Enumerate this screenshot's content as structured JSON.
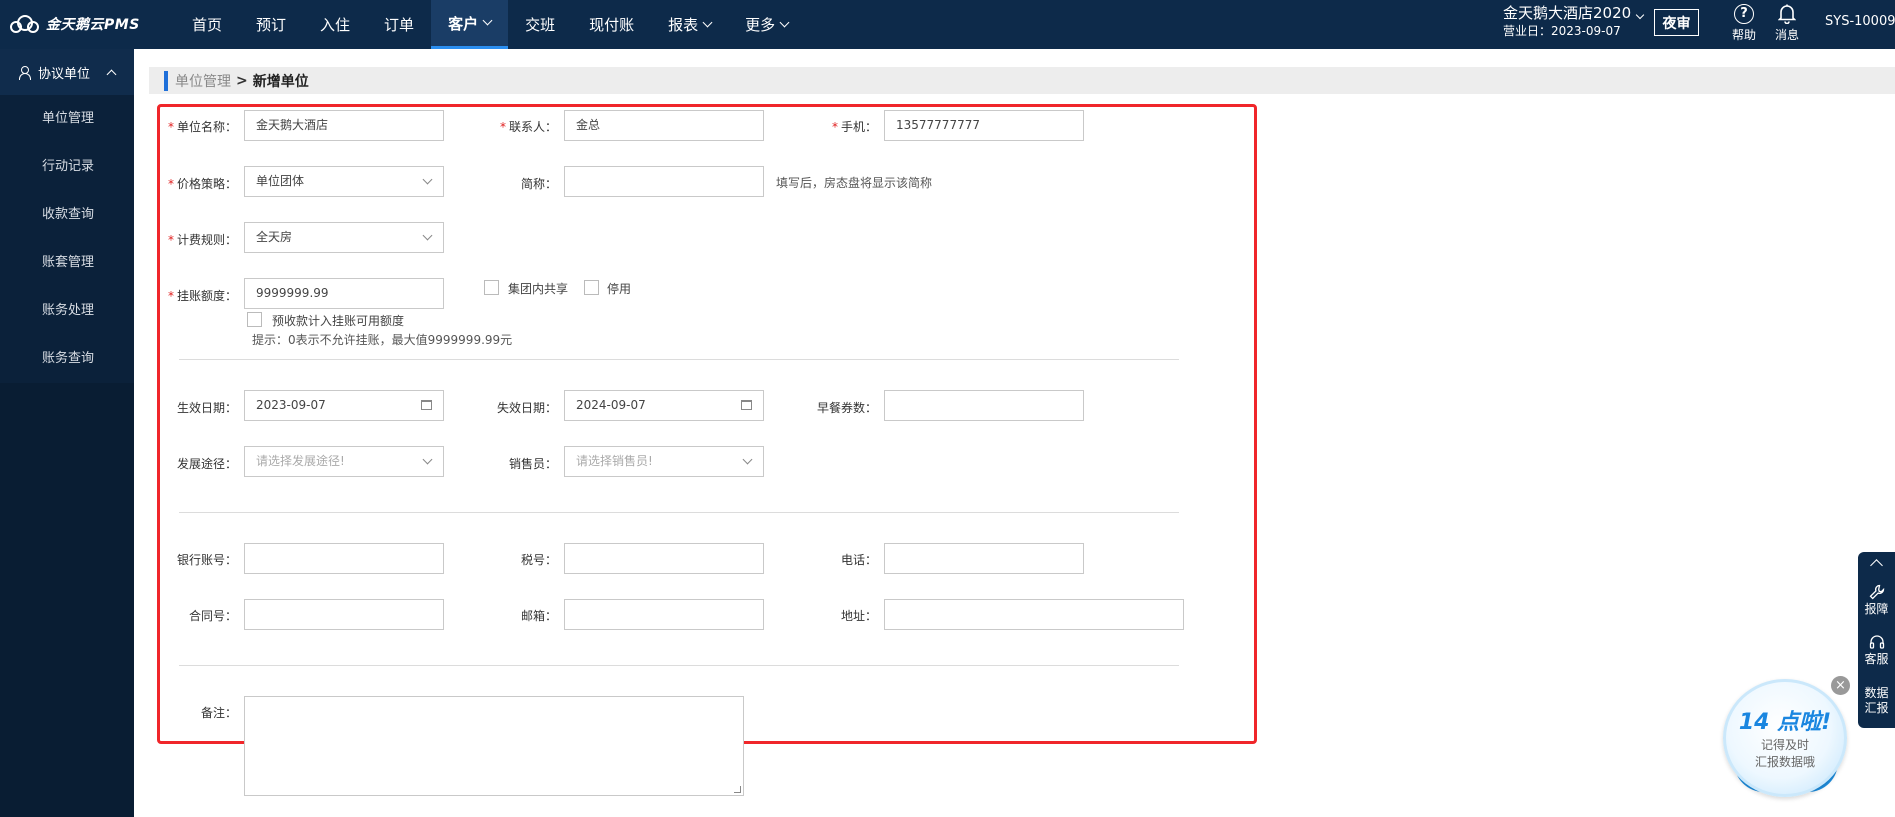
{
  "app": {
    "logo_text": "金天鹅云PMS"
  },
  "nav": {
    "items": [
      {
        "label": "首页"
      },
      {
        "label": "预订"
      },
      {
        "label": "入住"
      },
      {
        "label": "订单"
      },
      {
        "label": "客户"
      },
      {
        "label": "交班"
      },
      {
        "label": "现付账"
      },
      {
        "label": "报表"
      },
      {
        "label": "更多"
      }
    ]
  },
  "header": {
    "hotel_name": "金天鹅大酒店2020",
    "business_date": "营业日：2023-09-07",
    "night_audit": "夜审",
    "help": "帮助",
    "messages": "消息",
    "user": "SYS-10009"
  },
  "sidebar": {
    "group": "协议单位",
    "items": [
      {
        "label": "单位管理"
      },
      {
        "label": "行动记录"
      },
      {
        "label": "收款查询"
      },
      {
        "label": "账套管理"
      },
      {
        "label": "账务处理"
      },
      {
        "label": "账务查询"
      }
    ]
  },
  "breadcrumb": {
    "parent": "单位管理",
    "sep": ">",
    "current": "新增单位"
  },
  "form": {
    "unit_name": {
      "label": "单位名称：",
      "value": "金天鹅大酒店"
    },
    "contact": {
      "label": "联系人：",
      "value": "金总"
    },
    "mobile": {
      "label": "手机：",
      "value": "13577777777"
    },
    "price_policy": {
      "label": "价格策略：",
      "value": "单位团体"
    },
    "short_name": {
      "label": "简称：",
      "value": "",
      "hint": "填写后，房态盘将显示该简称"
    },
    "billing_rule": {
      "label": "计费规则：",
      "value": "全天房"
    },
    "credit_limit": {
      "label": "挂账额度：",
      "value": "9999999.99"
    },
    "group_share": {
      "label": "集团内共享",
      "checked": false
    },
    "disabled": {
      "label": "停用",
      "checked": false
    },
    "prepay_in_limit": {
      "label": "预收款计入挂账可用额度",
      "checked": false
    },
    "credit_hint": "提示：0表示不允许挂账，最大值9999999.99元",
    "effective_date": {
      "label": "生效日期：",
      "value": "2023-09-07"
    },
    "expiry_date": {
      "label": "失效日期：",
      "value": "2024-09-07"
    },
    "breakfast_coupons": {
      "label": "早餐券数：",
      "value": ""
    },
    "dev_channel": {
      "label": "发展途径：",
      "placeholder": "请选择发展途径!"
    },
    "salesperson": {
      "label": "销售员：",
      "placeholder": "请选择销售员!"
    },
    "bank_account": {
      "label": "银行账号：",
      "value": ""
    },
    "tax_no": {
      "label": "税号：",
      "value": ""
    },
    "phone": {
      "label": "电话：",
      "value": ""
    },
    "contract_no": {
      "label": "合同号：",
      "value": ""
    },
    "email": {
      "label": "邮箱：",
      "value": ""
    },
    "address": {
      "label": "地址：",
      "value": ""
    },
    "remark": {
      "label": "备注：",
      "value": ""
    }
  },
  "float_tools": {
    "report": "报障",
    "service": "客服",
    "data_report": "数据汇报"
  },
  "badge": {
    "title": "14 点啦!",
    "line1": "记得及时",
    "line2": "汇报数据哦"
  },
  "colors": {
    "nav_bg": "#0d2a4a",
    "sidebar_bg": "#091d33",
    "accent": "#1e6fd9",
    "highlight": "#f0262a",
    "required": "#e02020"
  }
}
